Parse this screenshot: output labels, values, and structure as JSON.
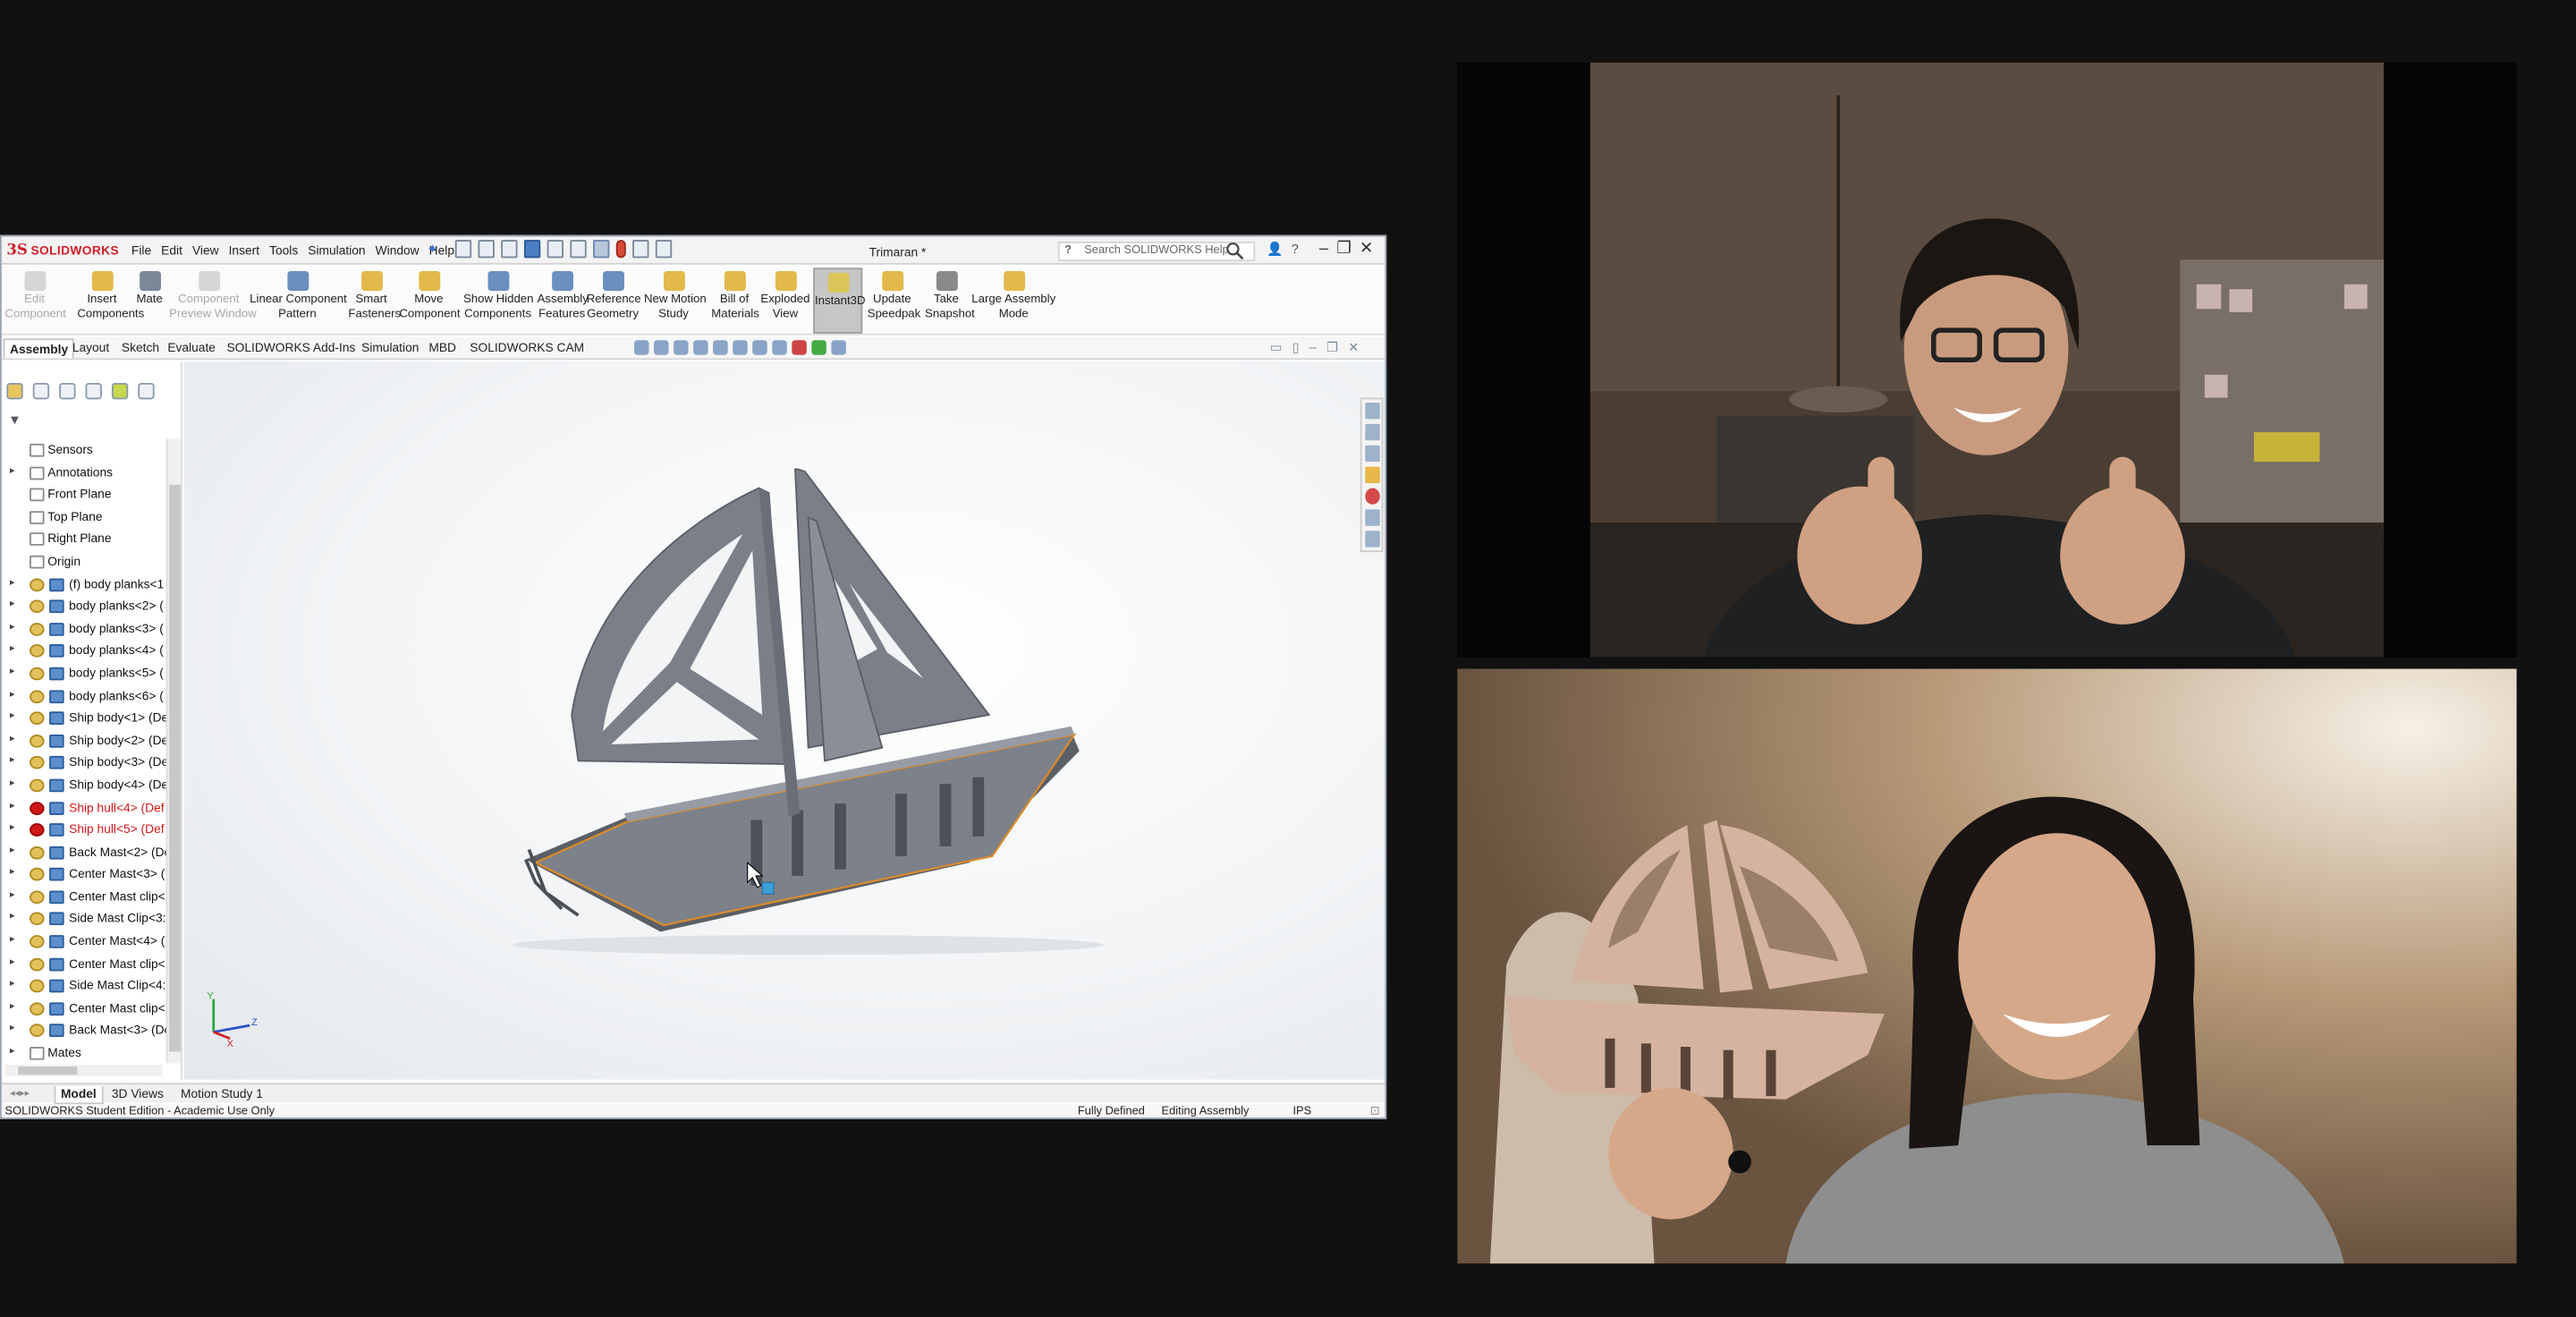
{
  "app": {
    "brand": "SOLIDWORKS",
    "menus": [
      "File",
      "Edit",
      "View",
      "Insert",
      "Tools",
      "Simulation",
      "Window",
      "Help"
    ],
    "document_title": "Trimaran *",
    "search_placeholder": "Search SOLIDWORKS Help"
  },
  "command_manager": {
    "buttons": [
      {
        "label": "Edit\nComponent",
        "enabled": false,
        "icon": "edit-component-icon"
      },
      {
        "label": "Insert\nComponents",
        "enabled": true,
        "icon": "insert-components-icon"
      },
      {
        "label": "Mate",
        "enabled": true,
        "icon": "mate-icon"
      },
      {
        "label": "Component\nPreview Window",
        "enabled": false,
        "icon": "preview-window-icon"
      },
      {
        "label": "Linear Component\nPattern",
        "enabled": true,
        "icon": "linear-pattern-icon"
      },
      {
        "label": "Smart\nFasteners",
        "enabled": true,
        "icon": "smart-fasteners-icon"
      },
      {
        "label": "Move\nComponent",
        "enabled": true,
        "icon": "move-component-icon"
      },
      {
        "label": "Show Hidden\nComponents",
        "enabled": true,
        "icon": "show-hidden-icon"
      },
      {
        "label": "Assembly\nFeatures",
        "enabled": true,
        "icon": "assembly-features-icon"
      },
      {
        "label": "Reference\nGeometry",
        "enabled": true,
        "icon": "reference-geometry-icon"
      },
      {
        "label": "New Motion\nStudy",
        "enabled": true,
        "icon": "motion-study-icon"
      },
      {
        "label": "Bill of\nMaterials",
        "enabled": true,
        "icon": "bom-icon"
      },
      {
        "label": "Exploded\nView",
        "enabled": true,
        "icon": "exploded-view-icon"
      },
      {
        "label": "Instant3D",
        "enabled": true,
        "active": true,
        "icon": "instant3d-icon"
      },
      {
        "label": "Update\nSpeedpak",
        "enabled": true,
        "icon": "speedpak-icon"
      },
      {
        "label": "Take\nSnapshot",
        "enabled": true,
        "icon": "camera-icon"
      },
      {
        "label": "Large Assembly\nMode",
        "enabled": true,
        "icon": "large-assembly-icon"
      }
    ]
  },
  "tabs": [
    "Assembly",
    "Layout",
    "Sketch",
    "Evaluate",
    "SOLIDWORKS Add-Ins",
    "Simulation",
    "MBD",
    "SOLIDWORKS CAM"
  ],
  "active_tab": "Assembly",
  "feature_tree": [
    {
      "label": "Sensors",
      "icon": "sensor",
      "expand": false
    },
    {
      "label": "Annotations",
      "icon": "annotation",
      "expand": true
    },
    {
      "label": "Front Plane",
      "icon": "plane",
      "expand": false
    },
    {
      "label": "Top Plane",
      "icon": "plane",
      "expand": false
    },
    {
      "label": "Right Plane",
      "icon": "plane",
      "expand": false
    },
    {
      "label": "Origin",
      "icon": "origin",
      "expand": false
    },
    {
      "label": "(f) body planks<1",
      "icon": "part",
      "expand": true
    },
    {
      "label": "body planks<2> (",
      "icon": "part",
      "expand": true
    },
    {
      "label": "body planks<3> (",
      "icon": "part",
      "expand": true
    },
    {
      "label": "body planks<4> (",
      "icon": "part",
      "expand": true
    },
    {
      "label": "body planks<5> (",
      "icon": "part",
      "expand": true
    },
    {
      "label": "body planks<6> (",
      "icon": "part",
      "expand": true
    },
    {
      "label": "Ship body<1> (De",
      "icon": "part",
      "expand": true
    },
    {
      "label": "Ship body<2> (De",
      "icon": "part",
      "expand": true
    },
    {
      "label": "Ship body<3> (De",
      "icon": "part",
      "expand": true
    },
    {
      "label": "Ship body<4> (De",
      "icon": "part",
      "expand": true
    },
    {
      "label": "Ship hull<4> (Def",
      "icon": "error",
      "expand": true,
      "error": true
    },
    {
      "label": "Ship hull<5> (Def",
      "icon": "error",
      "expand": true,
      "error": true
    },
    {
      "label": "Back Mast<2> (De",
      "icon": "part",
      "expand": true
    },
    {
      "label": "Center Mast<3> (",
      "icon": "part",
      "expand": true
    },
    {
      "label": "Center Mast clip<",
      "icon": "part",
      "expand": true
    },
    {
      "label": "Side Mast Clip<3:",
      "icon": "part",
      "expand": true
    },
    {
      "label": "Center Mast<4> (",
      "icon": "part",
      "expand": true
    },
    {
      "label": "Center Mast clip<",
      "icon": "part",
      "expand": true
    },
    {
      "label": "Side Mast Clip<4:",
      "icon": "part",
      "expand": true
    },
    {
      "label": "Center Mast clip<",
      "icon": "part",
      "expand": true
    },
    {
      "label": "Back Mast<3> (De",
      "icon": "part",
      "expand": true
    },
    {
      "label": "Mates",
      "icon": "mates",
      "expand": true
    }
  ],
  "bottom_tabs": [
    "Model",
    "3D Views",
    "Motion Study 1"
  ],
  "active_bottom_tab": "Model",
  "status": {
    "edition": "SOLIDWORKS Student Edition - Academic Use Only",
    "definition": "Fully Defined",
    "mode": "Editing Assembly",
    "units": "IPS"
  },
  "triad": {
    "x": "X",
    "y": "Y",
    "z": "Z"
  },
  "colors": {
    "brand_red": "#d0202b",
    "model_gray": "#7b7f88",
    "selection_orange": "#d98b2b",
    "error_red": "#d01818"
  }
}
